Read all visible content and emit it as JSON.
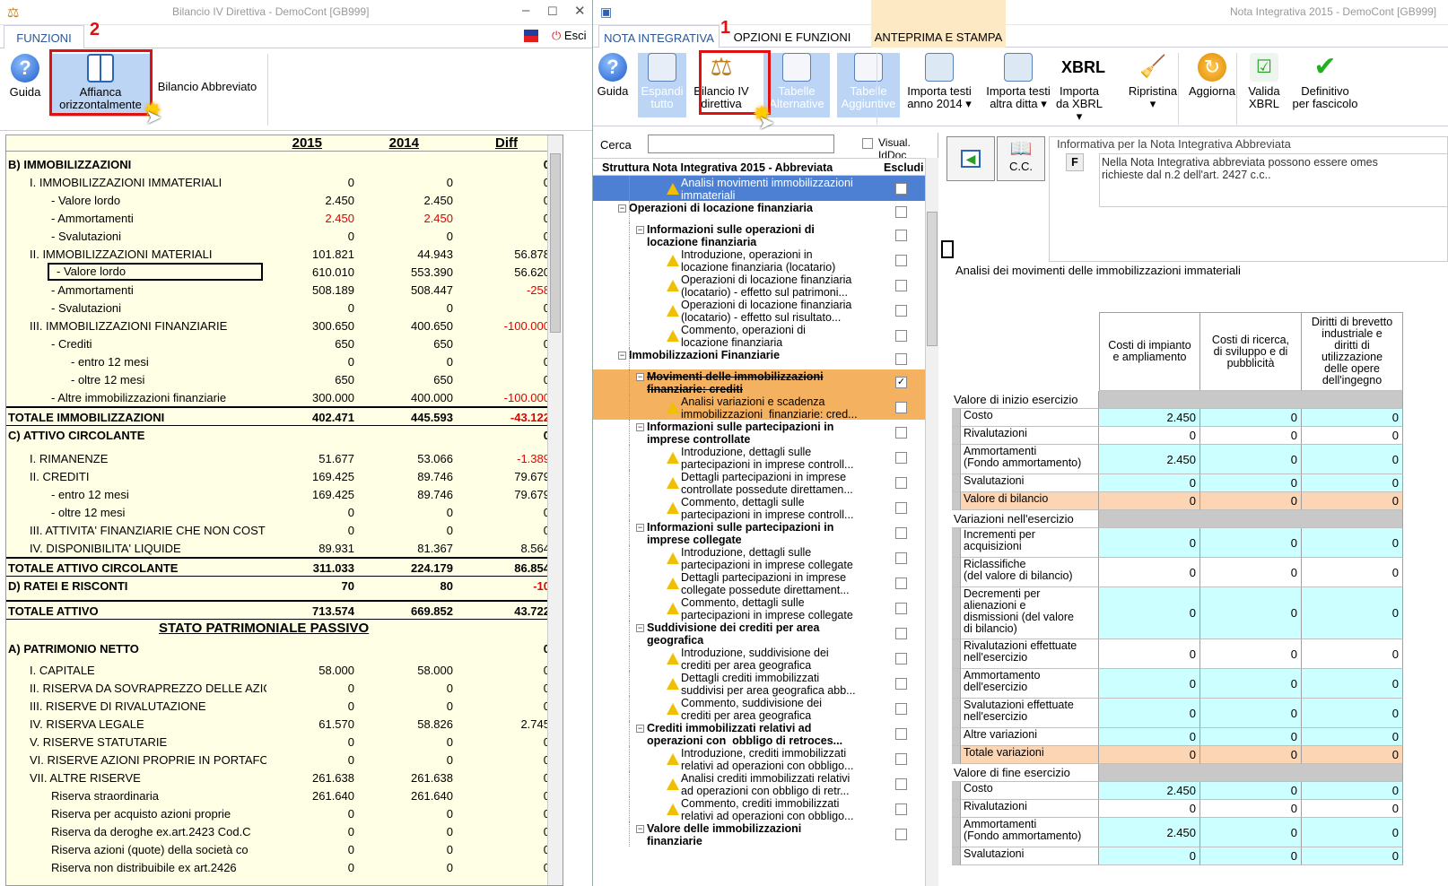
{
  "left": {
    "title": "Bilancio IV Direttiva - DemoCont [GB999]",
    "tab": "FUNZIONI",
    "step_number": "2",
    "exit": "Esci",
    "buttons": {
      "guida": "Guida",
      "affianca1": "Affianca",
      "affianca2": "orizzontalmente",
      "abbreviato": "Bilancio Abbreviato"
    },
    "headers": [
      "2015",
      "2014",
      "Diff"
    ],
    "rows": [
      {
        "label": "B) IMMOBILIZZAZIONI",
        "v1": "",
        "v2": "",
        "v3": "0",
        "style": "bold",
        "indent": 0
      },
      {
        "label": "I. IMMOBILIZZAZIONI IMMATERIALI",
        "v1": "0",
        "v2": "0",
        "v3": "0",
        "indent": 1
      },
      {
        "label": "- Valore lordo",
        "v1": "2.450",
        "v2": "2.450",
        "v3": "0",
        "indent": 2
      },
      {
        "label": "- Ammortamenti",
        "v1": "2.450",
        "v2": "2.450",
        "v3": "0",
        "indent": 2,
        "red12": true
      },
      {
        "label": "- Svalutazioni",
        "v1": "0",
        "v2": "0",
        "v3": "0",
        "indent": 2
      },
      {
        "label": "II. IMMOBILIZZAZIONI MATERIALI",
        "v1": "101.821",
        "v2": "44.943",
        "v3": "56.878",
        "indent": 1
      },
      {
        "label": "- Valore lordo",
        "v1": "610.010",
        "v2": "553.390",
        "v3": "56.620",
        "indent": 2,
        "boxed": true
      },
      {
        "label": "- Ammortamenti",
        "v1": "508.189",
        "v2": "508.447",
        "v3": "-258",
        "indent": 2,
        "red3": true
      },
      {
        "label": "- Svalutazioni",
        "v1": "0",
        "v2": "0",
        "v3": "0",
        "indent": 2
      },
      {
        "label": "III. IMMOBILIZZAZIONI FINANZIARIE",
        "v1": "300.650",
        "v2": "400.650",
        "v3": "-100.000",
        "indent": 1,
        "red3": true
      },
      {
        "label": "- Crediti",
        "v1": "650",
        "v2": "650",
        "v3": "0",
        "indent": 2
      },
      {
        "label": "- entro 12 mesi",
        "v1": "0",
        "v2": "0",
        "v3": "0",
        "indent": 3
      },
      {
        "label": "- oltre 12 mesi",
        "v1": "650",
        "v2": "650",
        "v3": "0",
        "indent": 3
      },
      {
        "label": "- Altre immobilizzazioni finanziarie",
        "v1": "300.000",
        "v2": "400.000",
        "v3": "-100.000",
        "indent": 2,
        "red3": true
      },
      {
        "label": "TOTALE IMMOBILIZZAZIONI",
        "v1": "402.471",
        "v2": "445.593",
        "v3": "-43.122",
        "style": "tot",
        "indent": 0,
        "red3": true
      },
      {
        "label": "C) ATTIVO CIRCOLANTE",
        "v1": "",
        "v2": "",
        "v3": "0",
        "style": "bold",
        "indent": 0
      },
      {
        "label": "I. RIMANENZE",
        "v1": "51.677",
        "v2": "53.066",
        "v3": "-1.389",
        "indent": 1,
        "red3": true
      },
      {
        "label": "II. CREDITI",
        "v1": "169.425",
        "v2": "89.746",
        "v3": "79.679",
        "indent": 1
      },
      {
        "label": "- entro 12 mesi",
        "v1": "169.425",
        "v2": "89.746",
        "v3": "79.679",
        "indent": 2
      },
      {
        "label": "- oltre 12 mesi",
        "v1": "0",
        "v2": "0",
        "v3": "0",
        "indent": 2
      },
      {
        "label": "III. ATTIVITA' FINANZIARIE CHE NON COST",
        "v1": "0",
        "v2": "0",
        "v3": "0",
        "indent": 1
      },
      {
        "label": "IV. DISPONIBILITA' LIQUIDE",
        "v1": "89.931",
        "v2": "81.367",
        "v3": "8.564",
        "indent": 1
      },
      {
        "label": "TOTALE ATTIVO CIRCOLANTE",
        "v1": "311.033",
        "v2": "224.179",
        "v3": "86.854",
        "style": "tot",
        "indent": 0
      },
      {
        "label": "D) RATEI E RISCONTI",
        "v1": "70",
        "v2": "80",
        "v3": "-10",
        "style": "bold",
        "indent": 0,
        "red3": true
      },
      {
        "label": "TOTALE ATTIVO",
        "v1": "713.574",
        "v2": "669.852",
        "v3": "43.722",
        "style": "tot",
        "indent": 0
      },
      {
        "label": "STATO PATRIMONIALE PASSIVO",
        "v1": "",
        "v2": "",
        "v3": "",
        "style": "section",
        "indent": 0
      },
      {
        "label": "A) PATRIMONIO NETTO",
        "v1": "",
        "v2": "",
        "v3": "0",
        "style": "bold",
        "indent": 0
      },
      {
        "label": "I. CAPITALE",
        "v1": "58.000",
        "v2": "58.000",
        "v3": "0",
        "indent": 1
      },
      {
        "label": "II. RISERVA DA SOVRAPREZZO DELLE AZIO",
        "v1": "0",
        "v2": "0",
        "v3": "0",
        "indent": 1
      },
      {
        "label": "III. RISERVE DI RIVALUTAZIONE",
        "v1": "0",
        "v2": "0",
        "v3": "0",
        "indent": 1
      },
      {
        "label": "IV. RISERVA LEGALE",
        "v1": "61.570",
        "v2": "58.826",
        "v3": "2.745",
        "indent": 1
      },
      {
        "label": "V. RISERVE STATUTARIE",
        "v1": "0",
        "v2": "0",
        "v3": "0",
        "indent": 1
      },
      {
        "label": "VI. RISERVE AZIONI PROPRIE IN PORTAFOG",
        "v1": "0",
        "v2": "0",
        "v3": "0",
        "indent": 1
      },
      {
        "label": "VII. ALTRE RISERVE",
        "v1": "261.638",
        "v2": "261.638",
        "v3": "0",
        "indent": 1
      },
      {
        "label": "Riserva straordinaria",
        "v1": "261.640",
        "v2": "261.640",
        "v3": "0",
        "indent": 2
      },
      {
        "label": "Riserva per acquisto azioni proprie",
        "v1": "0",
        "v2": "0",
        "v3": "0",
        "indent": 2
      },
      {
        "label": "Riserva da deroghe ex.art.2423 Cod.C",
        "v1": "0",
        "v2": "0",
        "v3": "0",
        "indent": 2
      },
      {
        "label": "Riserva azioni (quote) della società co",
        "v1": "0",
        "v2": "0",
        "v3": "0",
        "indent": 2
      },
      {
        "label": "Riserva non distribuibile ex art.2426",
        "v1": "0",
        "v2": "0",
        "v3": "0",
        "indent": 2
      }
    ]
  },
  "right": {
    "title": "Nota Integrativa 2015 - DemoCont [GB999]",
    "tabs": [
      "NOTA INTEGRATIVA",
      "OPZIONI E FUNZIONI",
      "ANTEPRIMA E STAMPA"
    ],
    "step_number": "1",
    "buttons": [
      {
        "l1": "Guida",
        "l2": ""
      },
      {
        "l1": "Espandi",
        "l2": "tutto"
      },
      {
        "l1": "Bilancio IV",
        "l2": "direttiva"
      },
      {
        "l1": "Tabelle",
        "l2": "Alternative"
      },
      {
        "l1": "Tabelle",
        "l2": "Aggiuntive"
      },
      {
        "l1": "Importa testi",
        "l2": "anno 2014 ▾"
      },
      {
        "l1": "Importa testi",
        "l2": "altra ditta ▾"
      },
      {
        "l1": "Importa",
        "l2": "da XBRL ▾"
      },
      {
        "l1": "Ripristina",
        "l2": "▾"
      },
      {
        "l1": "Aggiorna",
        "l2": ""
      },
      {
        "l1": "Valida",
        "l2": "XBRL"
      },
      {
        "l1": "Definitivo",
        "l2": "per fascicolo"
      }
    ],
    "search_label": "Cerca",
    "search_value": "",
    "visual_iddoc": "Visual. IdDoc",
    "tree_header": "Struttura Nota Integrativa 2015 - Abbreviata",
    "tree_exclude": "Escludi",
    "tree": [
      {
        "t": "Analisi movimenti immobilizzazioni\nimmateriali",
        "lvl": 3,
        "warn": true,
        "sel": "blue"
      },
      {
        "t": "Operazioni di locazione finanziaria",
        "lvl": 1,
        "bold": true
      },
      {
        "t": "Informazioni sulle operazioni di\nlocazione finanziaria",
        "lvl": 2,
        "bold": true
      },
      {
        "t": "Introduzione, operazioni in\nlocazione finanziaria (locatario)",
        "lvl": 3,
        "warn": true
      },
      {
        "t": "Operazioni di locazione finanziaria\n(locatario) - effetto sul patrimoni...",
        "lvl": 3,
        "warn": true
      },
      {
        "t": "Operazioni di locazione finanziaria\n(locatario) - effetto sul risultato...",
        "lvl": 3,
        "warn": true
      },
      {
        "t": "Commento, operazioni di\nlocazione finanziaria",
        "lvl": 3,
        "warn": true
      },
      {
        "t": "Immobilizzazioni Finanziarie",
        "lvl": 1,
        "bold": true
      },
      {
        "t": "Movimenti delle immobilizzazioni\nfinanziarie: crediti",
        "lvl": 2,
        "bold": true,
        "sel": "orange",
        "strike": true,
        "checked": true
      },
      {
        "t": "Analisi variazioni e scadenza\nimmobilizzazioni  finanziarie: cred...",
        "lvl": 3,
        "warn": true,
        "sel": "orange"
      },
      {
        "t": "Informazioni sulle partecipazioni in\nimprese controllate",
        "lvl": 2,
        "bold": true
      },
      {
        "t": "Introduzione, dettagli sulle\npartecipazioni in imprese controll...",
        "lvl": 3,
        "warn": true
      },
      {
        "t": "Dettagli partecipazioni in imprese\ncontrollate possedute direttamen...",
        "lvl": 3,
        "warn": true
      },
      {
        "t": "Commento, dettagli sulle\npartecipazioni in imprese controll...",
        "lvl": 3,
        "warn": true
      },
      {
        "t": "Informazioni sulle partecipazioni in\nimprese collegate",
        "lvl": 2,
        "bold": true
      },
      {
        "t": "Introduzione, dettagli sulle\npartecipazioni in imprese collegate",
        "lvl": 3,
        "warn": true
      },
      {
        "t": "Dettagli partecipazioni in imprese\ncollegate possedute direttament...",
        "lvl": 3,
        "warn": true
      },
      {
        "t": "Commento, dettagli sulle\npartecipazioni in imprese collegate",
        "lvl": 3,
        "warn": true
      },
      {
        "t": "Suddivisione dei crediti per area\ngeografica",
        "lvl": 2,
        "bold": true
      },
      {
        "t": "Introduzione, suddivisione dei\ncrediti per area geografica",
        "lvl": 3,
        "warn": true
      },
      {
        "t": "Dettagli crediti immobilizzati\nsuddivisi per area geografica abb...",
        "lvl": 3,
        "warn": true
      },
      {
        "t": "Commento, suddivisione dei\ncrediti per area geografica",
        "lvl": 3,
        "warn": true
      },
      {
        "t": "Crediti immobilizzati relativi ad\noperazioni con  obbligo di retroces...",
        "lvl": 2,
        "bold": true
      },
      {
        "t": "Introduzione, crediti immobilizzati\nrelativi ad operazioni con obbligo...",
        "lvl": 3,
        "warn": true
      },
      {
        "t": "Analisi crediti immobilizzati relativi\nad operazioni con obbligo di retr...",
        "lvl": 3,
        "warn": true
      },
      {
        "t": "Commento, crediti immobilizzati\nrelativi ad operazioni con obbligo...",
        "lvl": 3,
        "warn": true
      },
      {
        "t": "Valore delle immobilizzazioni\nfinanziarie",
        "lvl": 2,
        "bold": true
      }
    ],
    "cc_label": "C.C.",
    "info_title": "Informativa per la Nota Integrativa Abbreviata",
    "info_letter": "F",
    "info_text": "Nella Nota Integrativa abbreviata possono essere omes\nrichieste dal n.2 dell'art. 2427 c.c..",
    "section_title": "Analisi dei movimenti delle immobilizzazioni immateriali",
    "grid_cols": [
      "Costi di impianto\ne ampliamento",
      "Costi di ricerca,\ndi sviluppo e di\npubblicità",
      "Diritti di brevetto\nindustriale e\ndiritti di\nutilizzazione\ndelle opere\ndell'ingegno"
    ],
    "grid_rows": [
      {
        "label": "Valore di inizio esercizio",
        "group": true
      },
      {
        "label": "Costo",
        "vals": [
          "2.450",
          "0",
          "0"
        ],
        "c": "cyan",
        "h": 20
      },
      {
        "label": "Rivalutazioni",
        "vals": [
          "0",
          "0",
          "0"
        ],
        "c": "white",
        "h": 20
      },
      {
        "label": "Ammortamenti\n(Fondo ammortamento)",
        "vals": [
          "2.450",
          "0",
          "0"
        ],
        "c": "cyan",
        "h": 33
      },
      {
        "label": "Svalutazioni",
        "vals": [
          "0",
          "0",
          "0"
        ],
        "c": "cyan",
        "h": 20
      },
      {
        "label": "Valore di bilancio",
        "vals": [
          "0",
          "0",
          "0"
        ],
        "c": "peach",
        "h": 20
      },
      {
        "label": "Variazioni nell'esercizio",
        "group": true
      },
      {
        "label": "Incrementi per\nacquisizioni",
        "vals": [
          "0",
          "0",
          "0"
        ],
        "c": "cyan",
        "h": 33
      },
      {
        "label": "Riclassifiche\n(del valore di bilancio)",
        "vals": [
          "0",
          "0",
          "0"
        ],
        "c": "white",
        "h": 33
      },
      {
        "label": "Decrementi per\nalienazioni e\ndismissioni (del valore\ndi bilancio)",
        "vals": [
          "0",
          "0",
          "0"
        ],
        "c": "cyan",
        "h": 58
      },
      {
        "label": "Rivalutazioni effettuate\nnell'esercizio",
        "vals": [
          "0",
          "0",
          "0"
        ],
        "c": "white",
        "h": 33
      },
      {
        "label": "Ammortamento\ndell'esercizio",
        "vals": [
          "0",
          "0",
          "0"
        ],
        "c": "cyan",
        "h": 33
      },
      {
        "label": "Svalutazioni effettuate\nnell'esercizio",
        "vals": [
          "0",
          "0",
          "0"
        ],
        "c": "cyan",
        "h": 33
      },
      {
        "label": "Altre variazioni",
        "vals": [
          "0",
          "0",
          "0"
        ],
        "c": "cyan",
        "h": 20
      },
      {
        "label": "Totale variazioni",
        "vals": [
          "0",
          "0",
          "0"
        ],
        "c": "peach",
        "h": 20
      },
      {
        "label": "Valore di fine esercizio",
        "group": true
      },
      {
        "label": "Costo",
        "vals": [
          "2.450",
          "0",
          "0"
        ],
        "c": "cyan",
        "h": 20
      },
      {
        "label": "Rivalutazioni",
        "vals": [
          "0",
          "0",
          "0"
        ],
        "c": "white",
        "h": 20
      },
      {
        "label": "Ammortamenti\n(Fondo ammortamento)",
        "vals": [
          "2.450",
          "0",
          "0"
        ],
        "c": "cyan",
        "h": 33
      },
      {
        "label": "Svalutazioni",
        "vals": [
          "0",
          "0",
          "0"
        ],
        "c": "cyan",
        "h": 20
      }
    ]
  }
}
